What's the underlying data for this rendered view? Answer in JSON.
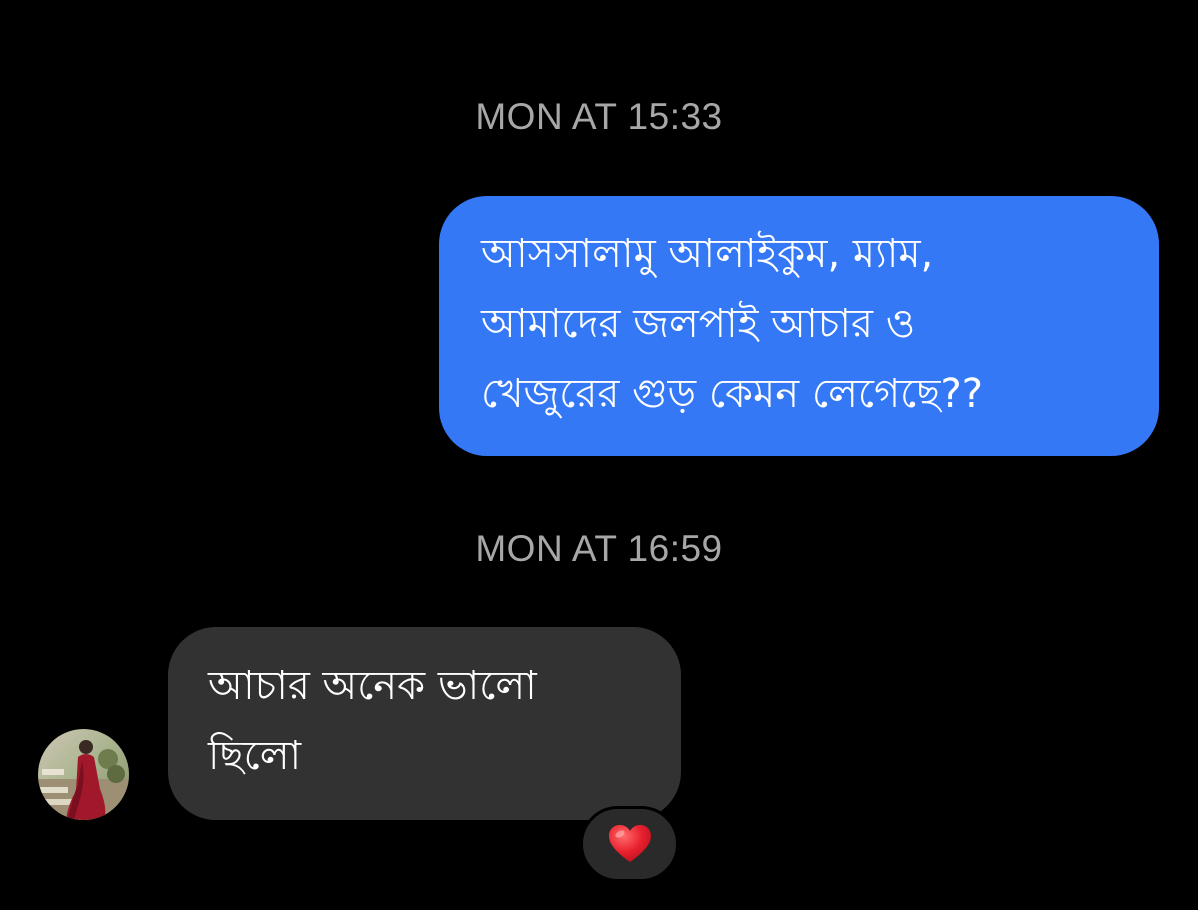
{
  "timestamps": [
    "MON AT 15:33",
    "MON AT 16:59"
  ],
  "messages": [
    {
      "direction": "outgoing",
      "bubble_color": "#3478f6",
      "lines": [
        "আসসালামু আলাইকুম, ম্যাম,",
        "আমাদের জলপাই আচার ও",
        "খেজুরের গুড় কেমন লেগেছে??"
      ]
    },
    {
      "direction": "incoming",
      "bubble_color": "#323232",
      "lines": [
        "আচার  অনেক ভালো",
        "ছিলো"
      ],
      "reaction": "heart-icon",
      "sender_avatar": "avatar"
    }
  ],
  "colors": {
    "background": "#000000",
    "timestamp": "#a7a7a7",
    "heart": "#e8202e"
  }
}
